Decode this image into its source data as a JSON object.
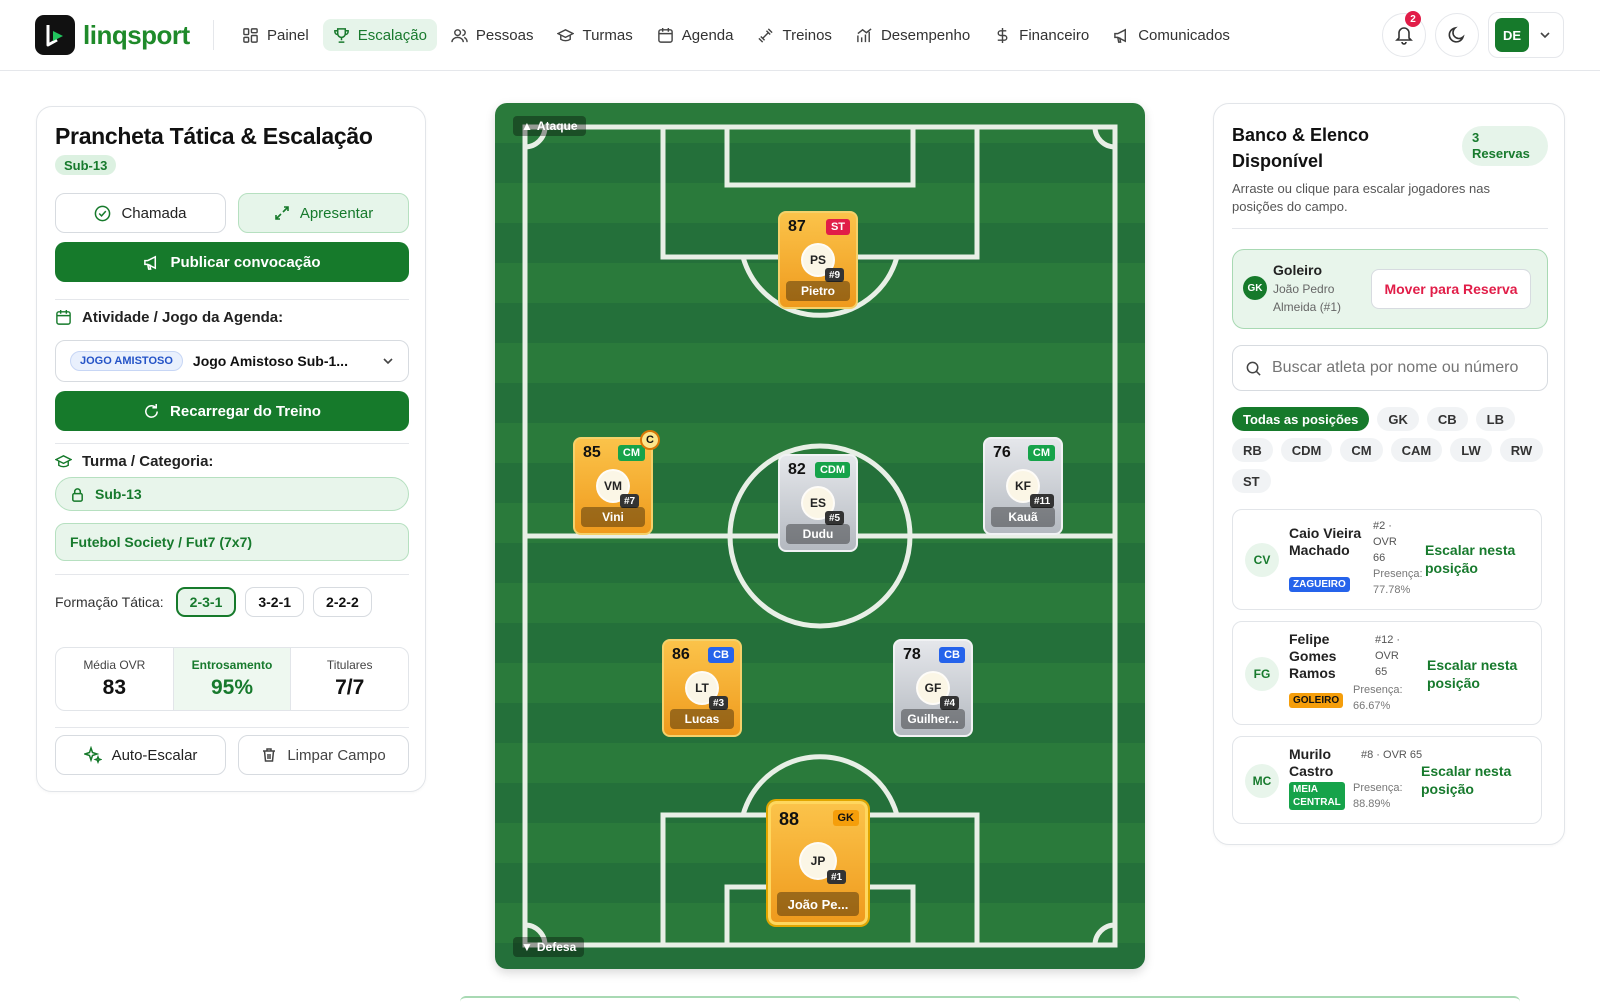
{
  "app": {
    "name": "linqsport"
  },
  "nav": [
    {
      "label": "Painel",
      "icon": "grid-icon"
    },
    {
      "label": "Escalação",
      "icon": "trophy-icon",
      "active": true
    },
    {
      "label": "Pessoas",
      "icon": "users-icon"
    },
    {
      "label": "Turmas",
      "icon": "graduation-cap-icon"
    },
    {
      "label": "Agenda",
      "icon": "calendar-icon"
    },
    {
      "label": "Treinos",
      "icon": "dumbbell-icon"
    },
    {
      "label": "Desempenho",
      "icon": "chart-icon"
    },
    {
      "label": "Financeiro",
      "icon": "dollar-icon"
    },
    {
      "label": "Comunicados",
      "icon": "megaphone-icon"
    }
  ],
  "header": {
    "notifications": "2",
    "user_initials": "DE"
  },
  "left": {
    "title": "Prancheta Tática & Escalação",
    "category_badge": "Sub-13",
    "chamada_label": "Chamada",
    "apresentar_label": "Apresentar",
    "publicar_label": "Publicar convocação",
    "activity_label": "Atividade / Jogo da Agenda:",
    "activity_tag": "JOGO AMISTOSO",
    "activity_value": "Jogo Amistoso Sub-1...",
    "reload_label": "Recarregar do Treino",
    "turma_label": "Turma / Categoria:",
    "turma_value": "Sub-13",
    "modalidade_value": "Futebol Society / Fut7 (7x7)",
    "formacao_label": "Formação Tática:",
    "formations": [
      "2-3-1",
      "3-2-1",
      "2-2-2"
    ],
    "active_formation": "2-3-1",
    "stats": [
      {
        "label": "Média OVR",
        "value": "83"
      },
      {
        "label": "Entrosamento",
        "value": "95%"
      },
      {
        "label": "Titulares",
        "value": "7/7"
      }
    ],
    "auto_label": "Auto-Escalar",
    "clear_label": "Limpar Campo"
  },
  "pitch": {
    "top_label": "Ataque",
    "bottom_label": "Defesa",
    "players": [
      {
        "ovr": "87",
        "pos": "ST",
        "pos_color": "#e11d48",
        "initials": "PS",
        "number": "#9",
        "name": "Pietro",
        "tier": "gold"
      },
      {
        "ovr": "85",
        "pos": "CM",
        "pos_color": "#16a34a",
        "initials": "VM",
        "number": "#7",
        "name": "Vini",
        "tier": "gold",
        "captain": "C"
      },
      {
        "ovr": "82",
        "pos": "CDM",
        "pos_color": "#16a34a",
        "initials": "ES",
        "number": "#5",
        "name": "Dudu",
        "tier": "silver"
      },
      {
        "ovr": "76",
        "pos": "CM",
        "pos_color": "#16a34a",
        "initials": "KF",
        "number": "#11",
        "name": "Kauã",
        "tier": "silver"
      },
      {
        "ovr": "86",
        "pos": "CB",
        "pos_color": "#2563eb",
        "initials": "LT",
        "number": "#3",
        "name": "Lucas",
        "tier": "gold"
      },
      {
        "ovr": "78",
        "pos": "CB",
        "pos_color": "#2563eb",
        "initials": "GF",
        "number": "#4",
        "name": "Guilher...",
        "tier": "silver"
      },
      {
        "ovr": "88",
        "pos": "GK",
        "pos_color": "#f59e0b",
        "initials": "JP",
        "number": "#1",
        "name": "João Pe...",
        "tier": "gold"
      }
    ]
  },
  "right": {
    "title": "Banco & Elenco Disponível",
    "reserves": "3 Reservas",
    "description": "Arraste ou clique para escalar jogadores nas posições do campo.",
    "gk_title": "Goleiro",
    "gk_badge": "GK",
    "gk_player": "João Pedro Almeida (#1)",
    "move_label": "Mover para Reserva",
    "search_placeholder": "Buscar atleta por nome ou número",
    "chips": [
      "Todas as posições",
      "GK",
      "CB",
      "LB",
      "RB",
      "CDM",
      "CM",
      "CAM",
      "LW",
      "RW",
      "ST"
    ],
    "bench": [
      {
        "initials": "CV",
        "name": "Caio Vieira Machado",
        "tag": "ZAGUEIRO",
        "tag_color": "#2563eb",
        "meta": "#2 · OVR 66",
        "presence": "Presença: 77.78%",
        "action": "Escalar nesta posição"
      },
      {
        "initials": "FG",
        "name": "Felipe Gomes Ramos",
        "tag": "GOLEIRO",
        "tag_color": "#f59e0b",
        "meta": "#12 · OVR 65",
        "presence": "Presença: 66.67%",
        "action": "Escalar nesta posição"
      },
      {
        "initials": "MC",
        "name": "Murilo Castro",
        "tag": "MEIA CENTRAL",
        "tag_color": "#16a34a",
        "meta": "#8 · OVR 65",
        "presence": "Presença: 88.89%",
        "action": "Escalar nesta posição"
      }
    ]
  }
}
